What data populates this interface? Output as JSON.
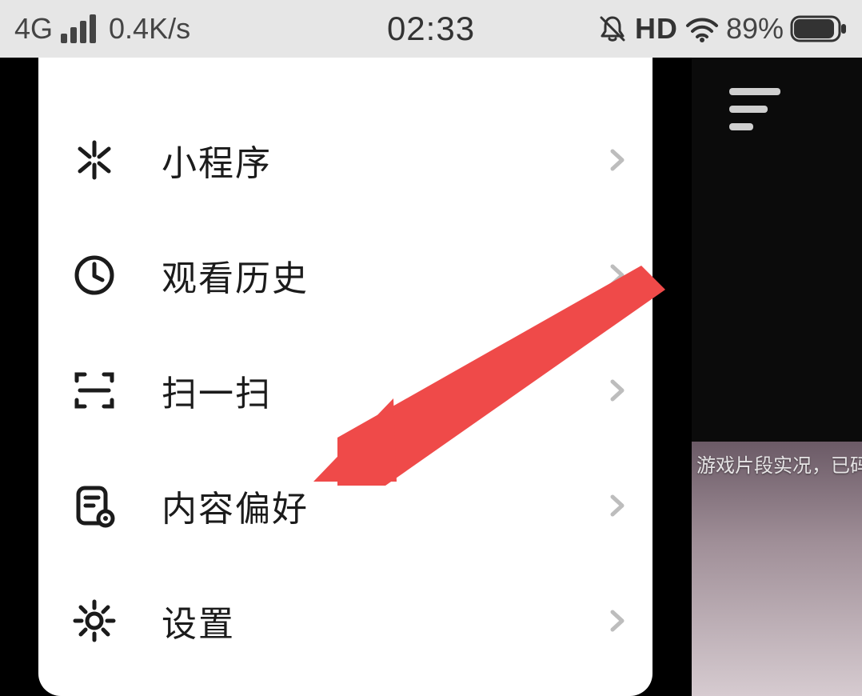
{
  "status_bar": {
    "network_type": "4G",
    "net_speed": "0.4K/s",
    "clock": "02:33",
    "hd_label": "HD",
    "battery_pct": "89%"
  },
  "menu": {
    "items": [
      {
        "label": "小程序"
      },
      {
        "label": "观看历史"
      },
      {
        "label": "扫一扫"
      },
      {
        "label": "内容偏好"
      },
      {
        "label": "设置"
      }
    ]
  },
  "background": {
    "video_caption": "游戏片段实况，已码，"
  },
  "annotation": {
    "arrow_color": "#ef4a49"
  }
}
